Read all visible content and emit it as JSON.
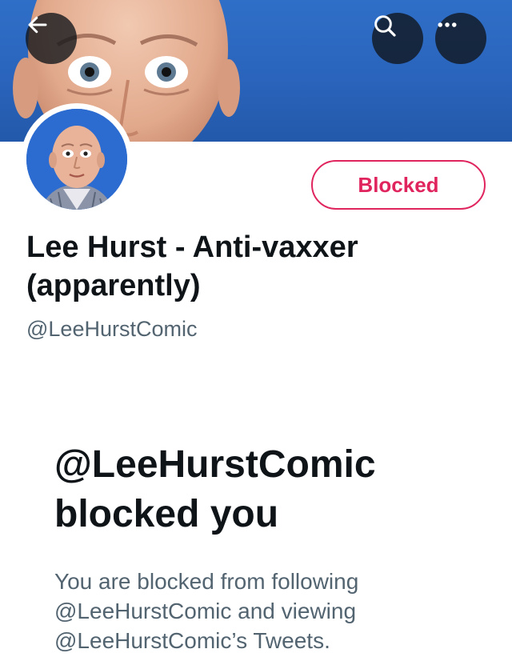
{
  "profile": {
    "display_name": "Lee Hurst - Anti-vaxxer (apparently)",
    "handle": "@LeeHurstComic",
    "follow_state_label": "Blocked"
  },
  "blocked_notice": {
    "title": "@LeeHurstComic blocked you",
    "description": "You are blocked from following @LeeHurstComic and viewing @LeeHurstComic’s Tweets."
  },
  "icons": {
    "back": "arrow-left-icon",
    "search": "search-icon",
    "more": "more-horizontal-icon"
  },
  "colors": {
    "blocked_red": "#e0245e",
    "banner_blue": "#2f6fc8",
    "text_primary": "#0f1419",
    "text_secondary": "#536471"
  }
}
